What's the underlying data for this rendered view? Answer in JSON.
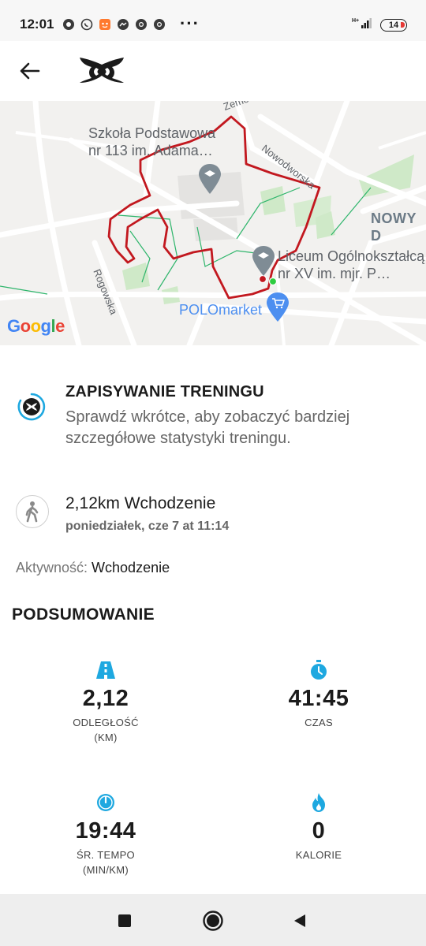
{
  "status_bar": {
    "time": "12:01",
    "more": "···",
    "battery": "14",
    "notification_icons": [
      "chat-icon",
      "whatsapp-icon",
      "app-icon",
      "messenger-icon",
      "chrome-icon",
      "chrome-icon"
    ]
  },
  "map": {
    "labels": {
      "school": "Szkoła Podstawowa\nnr 113 im. Adama…",
      "liceum": "Liceum Ogólnokształcą\nnr XV im. mjr. P…",
      "polomarket": "POLOmarket",
      "nowy": "NOWY D",
      "nowodworska": "Nowodworska",
      "rogowska": "Rogowska",
      "zemo": "Zemo"
    },
    "google": [
      "G",
      "o",
      "o",
      "g",
      "l",
      "e"
    ],
    "route_color": "#c2181f"
  },
  "recording": {
    "title": "ZAPISYWANIE TRENINGU",
    "description": "Sprawdź wkrótce, aby zobaczyć bardziej szczegółowe statystyki treningu."
  },
  "activity": {
    "title": "2,12km Wchodzenie",
    "date": "poniedziałek, cze 7 at 11:14",
    "type_label": "Aktywność:",
    "type_value": "Wchodzenie"
  },
  "summary": {
    "heading": "PODSUMOWANIE",
    "distance": {
      "value": "2,12",
      "label_1": "ODLEGŁOŚĆ",
      "label_2": "(KM)"
    },
    "time": {
      "value": "41:45",
      "label_1": "CZAS"
    },
    "pace": {
      "value": "19:44",
      "label_1": "ŚR. TEMPO",
      "label_2": "(MIN/KM)"
    },
    "calories": {
      "value": "0",
      "label_1": "KALORIE"
    }
  },
  "colors": {
    "accent_blue": "#1ea8e0",
    "route": "#c2181f",
    "brand": "#1b1b1b"
  }
}
